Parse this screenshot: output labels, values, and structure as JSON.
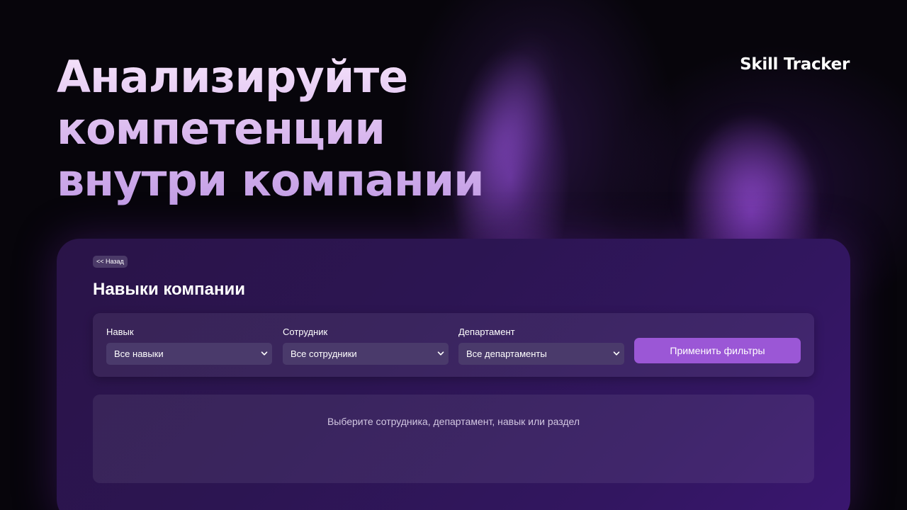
{
  "hero": {
    "title_lines": [
      "Анализируйте",
      "компетенции",
      "внутри компании"
    ]
  },
  "brand": {
    "name": "Skill Tracker"
  },
  "page": {
    "back_label": "<< Назад",
    "title": "Навыки компании"
  },
  "filters": {
    "skill": {
      "label": "Навык",
      "selected": "Все навыки"
    },
    "employee": {
      "label": "Сотрудник",
      "selected": "Все сотрудники"
    },
    "department": {
      "label": "Департамент",
      "selected": "Все департаменты"
    },
    "apply_label": "Применить фильтры"
  },
  "results": {
    "hint": "Выберите сотрудника, департамент, навык или раздел"
  },
  "icons": {
    "select_arrow": "chevron-down-icon"
  },
  "colors": {
    "accent": "#9b57d6",
    "panel": "#2c1552",
    "select_bg": "#4a3a6b",
    "hero_text": "#e8cff5"
  }
}
